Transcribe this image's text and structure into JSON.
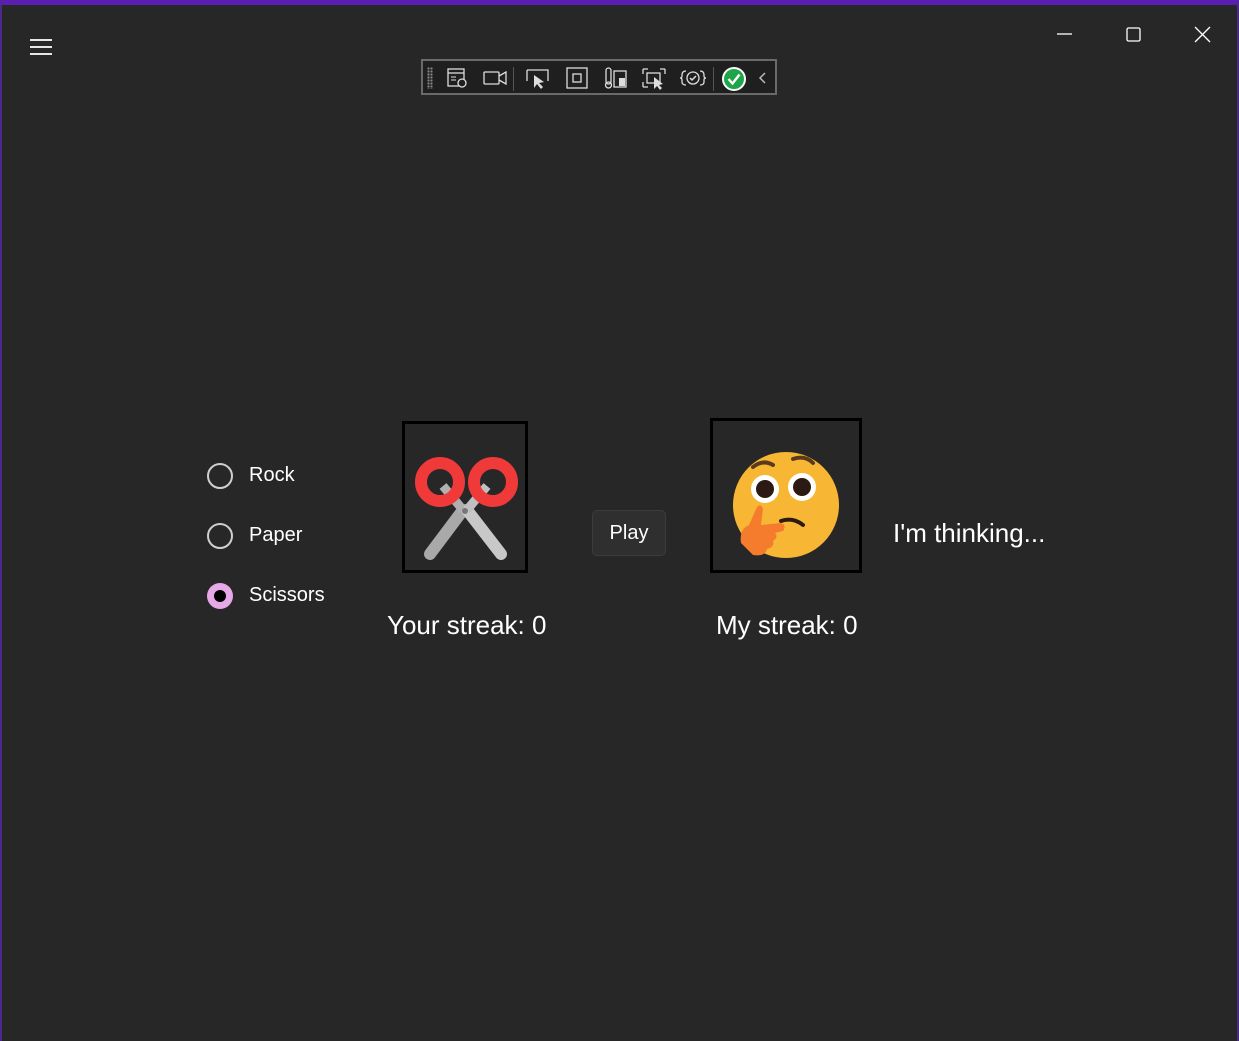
{
  "title_bar": {
    "minimize_icon": "minimize-icon",
    "maximize_icon": "maximize-icon",
    "close_icon": "close-icon"
  },
  "debug_toolbar": {
    "tools": [
      "live-visual-tree-icon",
      "record-icon",
      "select-element-icon",
      "display-layout-adorners-icon",
      "track-focus-icon",
      "select-element-preview-icon",
      "hot-reload-icon",
      "hot-reload-status-icon",
      "collapse-toolbar-icon"
    ]
  },
  "choices": {
    "options": [
      {
        "label": "Rock",
        "checked": false
      },
      {
        "label": "Paper",
        "checked": false
      },
      {
        "label": "Scissors",
        "checked": true
      }
    ]
  },
  "player": {
    "image": "scissors-icon",
    "streak": "Your streak: 0"
  },
  "play_button": "Play",
  "computer": {
    "image": "thinking-face-icon",
    "streak": "My streak: 0",
    "status": "I'm thinking..."
  },
  "colors": {
    "background": "#272727",
    "radio_checked": "#e6a8e6",
    "scissors_handle": "#f03a3a",
    "thinking_face": "#f7b735",
    "hand": "#f47c2c"
  }
}
